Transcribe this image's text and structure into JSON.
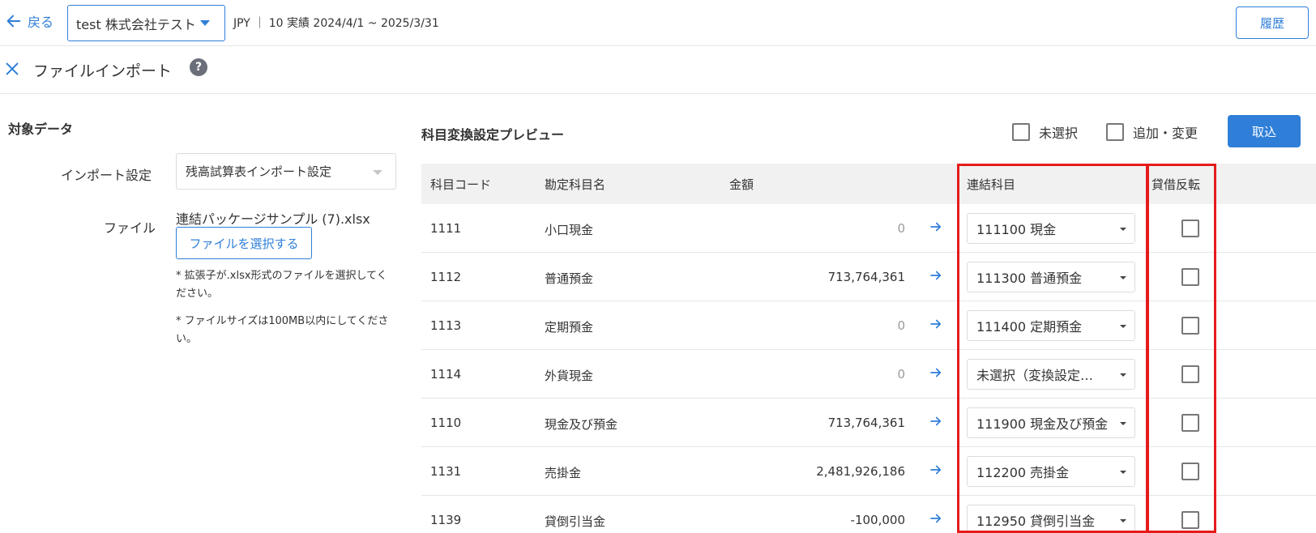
{
  "header": {
    "back_label": "戻る",
    "company": "test 株式会社テスト",
    "period": "JPY ｜ 10 実績 2024/4/1 ~ 2025/3/31",
    "history_label": "履歴"
  },
  "title_bar": {
    "title": "ファイルインポート",
    "help": "?"
  },
  "left_panel": {
    "heading": "対象データ",
    "import_setting_label": "インポート設定",
    "import_setting_value": "残高試算表インポート設定",
    "file_label": "ファイル",
    "file_name": "連結パッケージサンプル (7).xlsx",
    "select_file_button": "ファイルを選択する",
    "note1": "* 拡張子が.xlsx形式のファイルを選択してください。",
    "note2": "* ファイルサイズは100MB以内にしてください。"
  },
  "preview": {
    "title": "科目変換設定プレビュー",
    "legend_unselected": "未選択",
    "legend_added_changed": "追加・変更",
    "import_button": "取込",
    "columns": {
      "code": "科目コード",
      "name": "勘定科目名",
      "amount": "金額",
      "consolidated": "連結科目",
      "reverse": "貸借反転"
    },
    "rows": [
      {
        "code": "1111",
        "name": "小口現金",
        "amount": "0",
        "consolidated": "111100 現金",
        "reverse": false
      },
      {
        "code": "1112",
        "name": "普通預金",
        "amount": "713,764,361",
        "consolidated": "111300 普通預金",
        "reverse": false
      },
      {
        "code": "1113",
        "name": "定期預金",
        "amount": "0",
        "consolidated": "111400 定期預金",
        "reverse": false
      },
      {
        "code": "1114",
        "name": "外貨現金",
        "amount": "0",
        "consolidated": "未選択（変換設定…",
        "reverse": false
      },
      {
        "code": "1110",
        "name": "現金及び預金",
        "amount": "713,764,361",
        "consolidated": "111900 現金及び預金",
        "reverse": false
      },
      {
        "code": "1131",
        "name": "売掛金",
        "amount": "2,481,926,186",
        "consolidated": "112200 売掛金",
        "reverse": false
      },
      {
        "code": "1139",
        "name": "貸倒引当金",
        "amount": "-100,000",
        "consolidated": "112950 貸倒引当金",
        "reverse": false
      }
    ]
  },
  "colors": {
    "accent": "#2f7fd8",
    "highlight": "#e51b1b"
  }
}
